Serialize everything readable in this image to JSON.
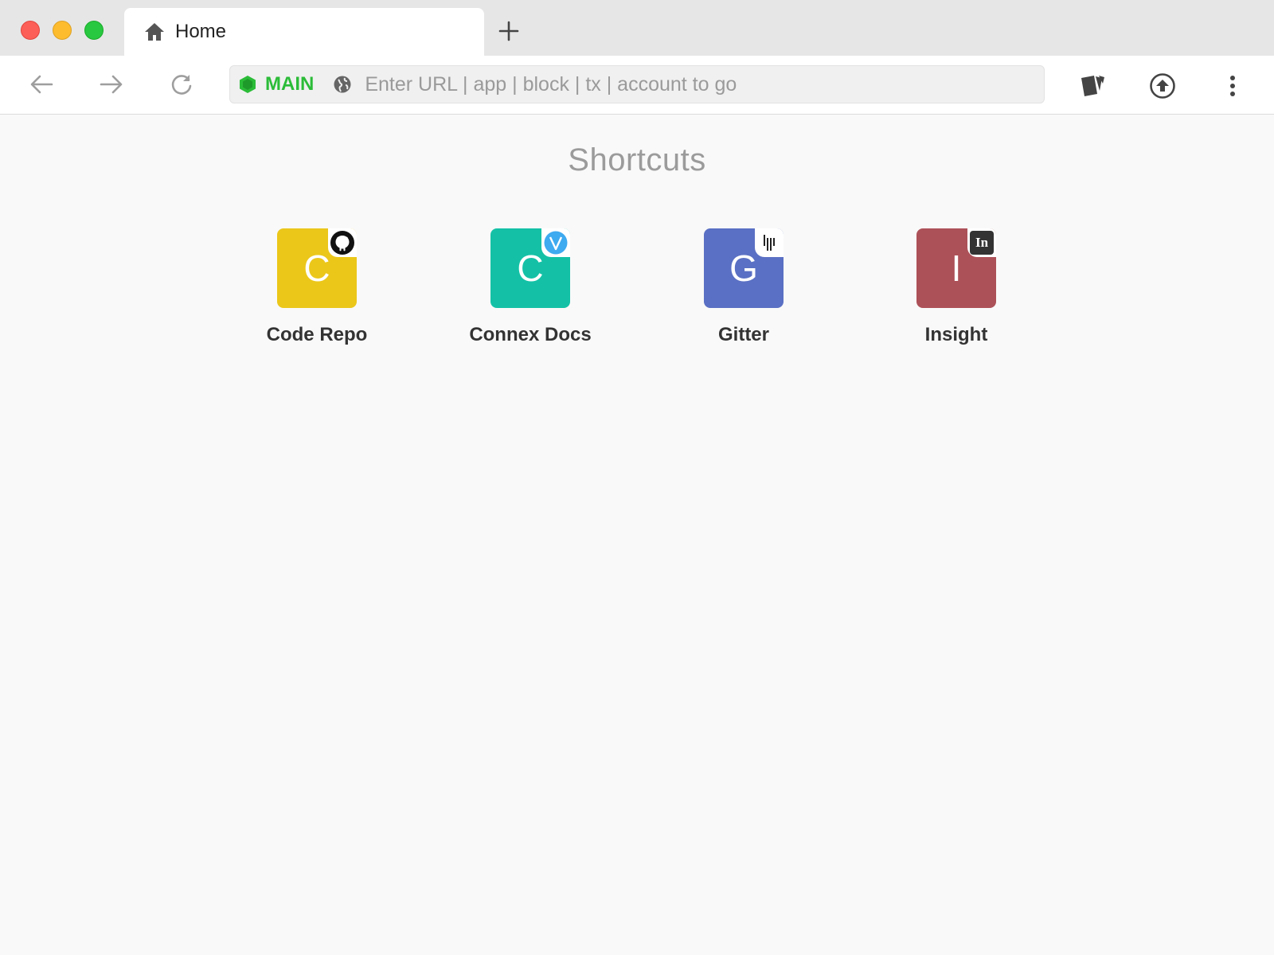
{
  "window": {
    "controls": [
      "close",
      "minimize",
      "maximize"
    ]
  },
  "tabs": [
    {
      "label": "Home",
      "icon": "home-icon",
      "active": true
    }
  ],
  "new_tab_icon": "plus-icon",
  "toolbar": {
    "back_icon": "arrow-left-icon",
    "forward_icon": "arrow-right-icon",
    "reload_icon": "reload-icon",
    "network": {
      "label": "MAIN",
      "icon": "hexagon-icon",
      "color": "#2bbc38"
    },
    "url": {
      "value": "",
      "placeholder": "Enter URL | app | block | tx | account to go",
      "icon": "globe-icon"
    },
    "right_icons": [
      "wallet-cards-icon",
      "upload-circle-icon",
      "more-vertical-icon"
    ]
  },
  "main": {
    "title": "Shortcuts",
    "shortcuts": [
      {
        "letter": "C",
        "label": "Code Repo",
        "color": "#ebc71a",
        "badge_icon": "github-icon"
      },
      {
        "letter": "C",
        "label": "Connex Docs",
        "color": "#14c1a6",
        "badge_icon": "vuepress-icon"
      },
      {
        "letter": "G",
        "label": "Gitter",
        "color": "#5a70c4",
        "badge_icon": "gitter-icon"
      },
      {
        "letter": "I",
        "label": "Insight",
        "color": "#ad5158",
        "badge_icon": "insight-icon",
        "badge_text": "In"
      }
    ]
  }
}
